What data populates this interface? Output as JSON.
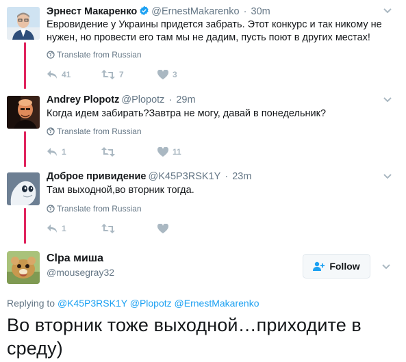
{
  "thread": [
    {
      "name": "Эрнест Макаренко",
      "verified": true,
      "handle": "@ErnestMakarenko",
      "time": "30m",
      "text": "Евровидение у Украины придется забрать. Этот конкурс и так никому не нужен, но провести его там мы не дадим, пусть поют в других местах!",
      "translate_label": "Translate from Russian",
      "replies": "41",
      "retweets": "7",
      "likes": "3"
    },
    {
      "name": "Andrey Plopotz",
      "verified": false,
      "handle": "@Plopotz",
      "time": "29m",
      "text": "Когда идем забирать?Завтра не могу, давай в понедельник?",
      "translate_label": "Translate from Russian",
      "replies": "1",
      "retweets": "",
      "likes": "11"
    },
    {
      "name": "Доброе привидение",
      "verified": false,
      "handle": "@K45P3RSK1Y",
      "time": "23m",
      "text": "Там выходной,во вторник тогда.",
      "translate_label": "Translate from Russian",
      "replies": "1",
      "retweets": "",
      "likes": ""
    }
  ],
  "main_tweet": {
    "name": "Clpa миша",
    "handle": "@mousegray32",
    "follow_label": "Follow",
    "replying_prefix": "Replying to",
    "mentions": [
      "@K45P3RSK1Y",
      "@Plopotz",
      "@ErnestMakarenko"
    ],
    "text": "Во вторник тоже выходной…приходите в среду)"
  },
  "icons": {
    "verified": "verified-badge-icon",
    "globe": "globe-icon",
    "reply": "reply-icon",
    "retweet": "retweet-icon",
    "like": "heart-icon",
    "caret": "chevron-down-icon",
    "follow": "follow-person-icon"
  },
  "colors": {
    "thread_line": "#e0245e",
    "link": "#1da1f2",
    "muted": "#657786",
    "action": "#aab8c2",
    "text": "#14171a"
  }
}
